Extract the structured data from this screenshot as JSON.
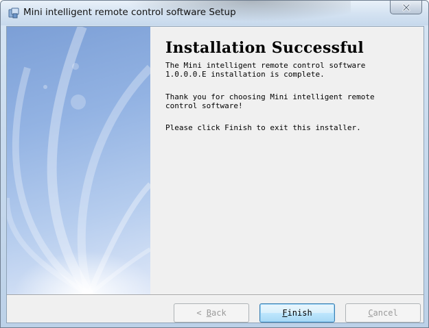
{
  "window": {
    "title": "Mini intelligent remote control software Setup",
    "icons": {
      "app": "installer-icon",
      "close": "close-icon"
    }
  },
  "content": {
    "heading": "Installation Successful",
    "paragraph_1": "The Mini intelligent remote control software\n1.0.0.0.E installation is complete.",
    "paragraph_2": "Thank you for choosing Mini intelligent remote\ncontrol software!",
    "paragraph_3": "Please click Finish to exit this installer."
  },
  "buttons": {
    "back": {
      "prefix": "< ",
      "accel": "B",
      "rest": "ack",
      "enabled": false
    },
    "finish": {
      "prefix": "",
      "accel": "F",
      "rest": "inish",
      "enabled": true,
      "default": true
    },
    "cancel": {
      "prefix": "",
      "accel": "C",
      "rest": "ancel",
      "enabled": false
    }
  },
  "colors": {
    "accent": "#3c7fb1",
    "side_panel": "#93b3e3",
    "dialog_bg": "#f0f0f0"
  }
}
